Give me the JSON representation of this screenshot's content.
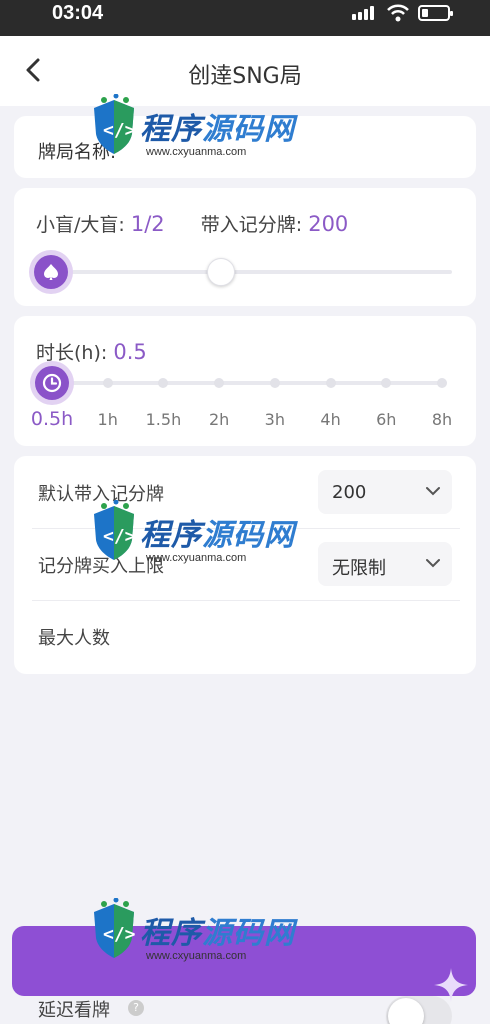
{
  "status_bar": {
    "time": "03:04"
  },
  "nav": {
    "title": "创逹SNG局"
  },
  "name_card": {
    "label": "牌局名称:"
  },
  "blind_card": {
    "blind_label": "小盲/大盲:",
    "blind_value": "1/2",
    "buyin_label": "带入记分牌:",
    "buyin_value": "200",
    "slider_level": 0.42
  },
  "duration_card": {
    "label": "时长(h):",
    "value": "0.5",
    "ticks": [
      "0.5h",
      "1h",
      "1.5h",
      "2h",
      "3h",
      "4h",
      "6h",
      "8h"
    ],
    "selected_index": 0
  },
  "settings_card": {
    "rows": [
      {
        "label": "默认带入记分牌",
        "select": "200"
      },
      {
        "label": "记分牌买入上限",
        "select": "无限制"
      },
      {
        "label": "最大人数"
      }
    ]
  },
  "footer": {
    "delay_label": "延迟看牌",
    "help": "?",
    "delay_enabled": false
  },
  "watermark": {
    "main_a": "程序",
    "main_b": "源码网",
    "sub": "www.cxyuanma.com"
  },
  "colors": {
    "accent": "#8e4fd4",
    "accent_text": "#8b5ac6",
    "status_bar": "#2b2b2b"
  }
}
